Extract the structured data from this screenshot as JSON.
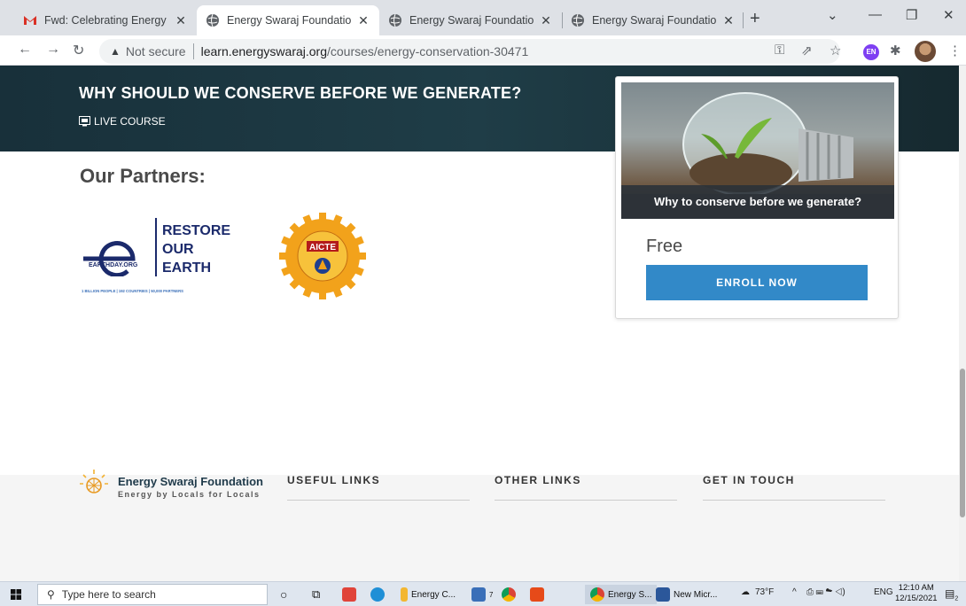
{
  "browser": {
    "tabs": [
      {
        "title": "Fwd: Celebrating Energy Co",
        "active": false
      },
      {
        "title": "Energy Swaraj Foundation",
        "active": true
      },
      {
        "title": "Energy Swaraj Foundation",
        "active": false
      },
      {
        "title": "Energy Swaraj Foundation",
        "active": false
      }
    ],
    "close_glyph": "✕",
    "new_tab": "+",
    "security_label": "Not secure",
    "url_host": "learn.energyswaraj.org",
    "url_path": "/courses/energy-conservation-30471",
    "profile_badge": "EN"
  },
  "hero": {
    "title": "WHY SHOULD WE CONSERVE BEFORE WE GENERATE?",
    "live_label": "LIVE COURSE"
  },
  "partners": {
    "heading": "Our Partners:",
    "earthday": {
      "line1": "RESTORE",
      "line2": "OUR",
      "line3": "EARTH",
      "org": "EARTHDAY.ORG",
      "stats": "1 BILLION PEOPLE | 192 COUNTRIES | 50,000 PARTNERS"
    },
    "aicte": {
      "label": "AICTE"
    }
  },
  "course_card": {
    "caption": "Why to conserve before we generate?",
    "price": "Free",
    "enroll_label": "ENROLL NOW"
  },
  "footer": {
    "brand": "Energy Swaraj Foundation",
    "tagline": "Energy by Locals for Locals",
    "headings": [
      "USEFUL LINKS",
      "OTHER LINKS",
      "GET IN TOUCH"
    ]
  },
  "taskbar": {
    "search_placeholder": "Type here to search",
    "apps": [
      "Energy C...",
      "Energy S...",
      "New Micr..."
    ],
    "mail_badge": "7",
    "weather": "73°F",
    "language": "ENG",
    "time": "12:10 AM",
    "date": "12/15/2021",
    "notifications": "2"
  },
  "colors": {
    "hero_bg": "#1d3943",
    "enroll_button": "#3289c8",
    "footer_bg": "#f5f5f5"
  }
}
